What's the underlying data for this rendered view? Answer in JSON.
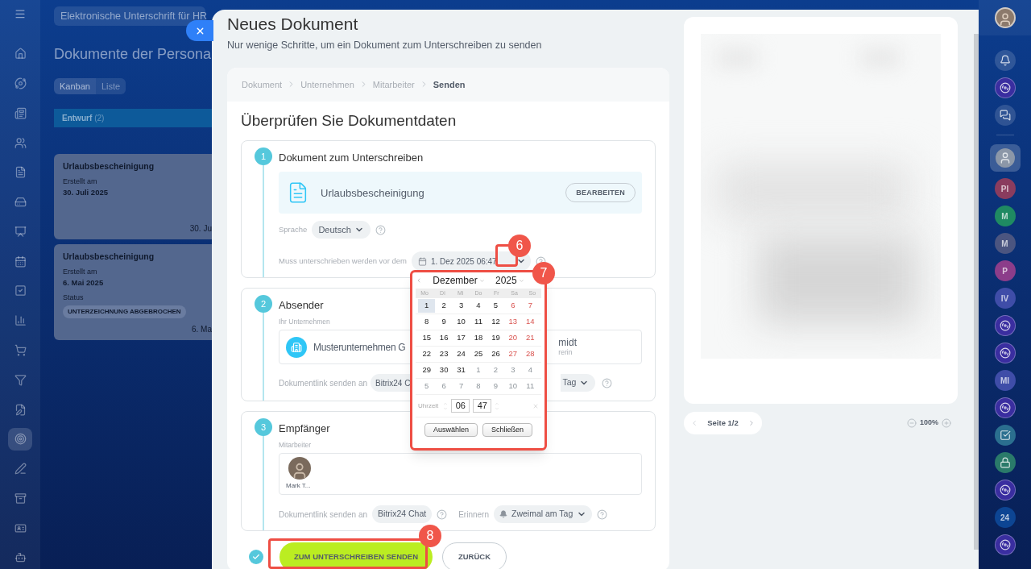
{
  "left_nav": [
    {
      "selected": false
    },
    {
      "selected": false
    },
    {
      "selected": false
    },
    {
      "selected": false
    },
    {
      "selected": false
    },
    {
      "selected": false
    },
    {
      "selected": false
    },
    {
      "selected": false
    },
    {
      "selected": false
    },
    {
      "selected": false
    },
    {
      "selected": false
    },
    {
      "selected": false
    },
    {
      "selected": false
    },
    {
      "selected": true
    },
    {
      "selected": false
    },
    {
      "selected": false
    },
    {
      "selected": false
    },
    {
      "selected": false
    }
  ],
  "background_page": {
    "search": "Elektronische Unterschrift für HR",
    "title": "Dokumente der Persona",
    "tabs": [
      {
        "label": "Kanban",
        "selected": true
      },
      {
        "label": "Liste",
        "selected": false
      }
    ],
    "column": {
      "title": "Entwurf",
      "count": "(2)"
    },
    "cards": [
      {
        "title": "Urlaubsbescheinigung",
        "created_label": "Erstellt am",
        "created_date": "30. Juli 2025",
        "footer": "30. Ju"
      },
      {
        "title": "Urlaubsbescheinigung",
        "created_label": "Erstellt am",
        "created_date": "6. Mai 2025",
        "status_label": "Status",
        "status": "UNTERZEICHNUNG ABGEBROCHEN",
        "footer": "6. Ma"
      }
    ]
  },
  "panel": {
    "title": "Neues Dokument",
    "subtitle": "Nur wenige Schritte, um ein Dokument zum Unterschreiben zu senden",
    "breadcrumb": [
      {
        "label": "Dokument",
        "selected": false
      },
      {
        "label": "Unternehmen",
        "selected": false
      },
      {
        "label": "Mitarbeiter",
        "selected": false
      },
      {
        "label": "Senden",
        "selected": true
      }
    ],
    "heading": "Überprüfen Sie Dokumentdaten",
    "step1": {
      "number": "1",
      "title": "Dokument zum Unterschreiben",
      "document": "Urlaubsbescheinigung",
      "edit_button": "BEARBEITEN",
      "language_label": "Sprache",
      "language": "Deutsch",
      "deadline_label": "Muss unterschrieben werden vor dem",
      "deadline": "1. Dez 2025 06:47"
    },
    "step2": {
      "number": "2",
      "title": "Absender",
      "company_label": "Ihr Unternehmen",
      "company": "Musterunternehmen G",
      "person_name": "midt",
      "person_role": "rerin",
      "link_label": "Dokumentlink senden an",
      "link_channel": "Bitrix24 C",
      "reminder": "Tag"
    },
    "step3": {
      "number": "3",
      "title": "Empfänger",
      "employee_label": "Mitarbeiter",
      "employee": "Mark T...",
      "link_label": "Dokumentlink senden an",
      "link_channel": "Bitrix24 Chat",
      "reminder_label": "Erinnern",
      "reminder": "Zweimal am Tag"
    },
    "send_button": "ZUM UNTERSCHREIBEN SENDEN",
    "back_button": "ZURÜCK"
  },
  "preview": {
    "page": "Seite 1/2",
    "zoom": "100%"
  },
  "calendar": {
    "month": "Dezember",
    "year": "2025",
    "weekdays": [
      "Mo",
      "Di",
      "Mi",
      "Do",
      "Fr",
      "Sa",
      "So"
    ],
    "weeks": [
      [
        {
          "day": "1",
          "kind": "weekday",
          "selected": true
        },
        {
          "day": "2",
          "kind": "weekday",
          "selected": false
        },
        {
          "day": "3",
          "kind": "weekday",
          "selected": false
        },
        {
          "day": "4",
          "kind": "weekday",
          "selected": false
        },
        {
          "day": "5",
          "kind": "weekday",
          "selected": false
        },
        {
          "day": "6",
          "kind": "weekend",
          "selected": false
        },
        {
          "day": "7",
          "kind": "weekend",
          "selected": false
        }
      ],
      [
        {
          "day": "8",
          "kind": "weekday",
          "selected": false
        },
        {
          "day": "9",
          "kind": "weekday",
          "selected": false
        },
        {
          "day": "10",
          "kind": "weekday",
          "selected": false
        },
        {
          "day": "11",
          "kind": "weekday",
          "selected": false
        },
        {
          "day": "12",
          "kind": "weekday",
          "selected": false
        },
        {
          "day": "13",
          "kind": "weekend",
          "selected": false
        },
        {
          "day": "14",
          "kind": "weekend",
          "selected": false
        }
      ],
      [
        {
          "day": "15",
          "kind": "weekday",
          "selected": false
        },
        {
          "day": "16",
          "kind": "weekday",
          "selected": false
        },
        {
          "day": "17",
          "kind": "weekday",
          "selected": false
        },
        {
          "day": "18",
          "kind": "weekday",
          "selected": false
        },
        {
          "day": "19",
          "kind": "weekday",
          "selected": false
        },
        {
          "day": "20",
          "kind": "weekend",
          "selected": false
        },
        {
          "day": "21",
          "kind": "weekend",
          "selected": false
        }
      ],
      [
        {
          "day": "22",
          "kind": "weekday",
          "selected": false
        },
        {
          "day": "23",
          "kind": "weekday",
          "selected": false
        },
        {
          "day": "24",
          "kind": "weekday",
          "selected": false
        },
        {
          "day": "25",
          "kind": "weekday",
          "selected": false
        },
        {
          "day": "26",
          "kind": "weekday",
          "selected": false
        },
        {
          "day": "27",
          "kind": "weekend",
          "selected": false
        },
        {
          "day": "28",
          "kind": "weekend",
          "selected": false
        }
      ],
      [
        {
          "day": "29",
          "kind": "weekday",
          "selected": false
        },
        {
          "day": "30",
          "kind": "weekday",
          "selected": false
        },
        {
          "day": "31",
          "kind": "weekday",
          "selected": false
        },
        {
          "day": "1",
          "kind": "other",
          "selected": false
        },
        {
          "day": "2",
          "kind": "other",
          "selected": false
        },
        {
          "day": "3",
          "kind": "other",
          "selected": false
        },
        {
          "day": "4",
          "kind": "other",
          "selected": false
        }
      ],
      [
        {
          "day": "5",
          "kind": "other",
          "selected": false
        },
        {
          "day": "6",
          "kind": "other",
          "selected": false
        },
        {
          "day": "7",
          "kind": "other",
          "selected": false
        },
        {
          "day": "8",
          "kind": "other",
          "selected": false
        },
        {
          "day": "9",
          "kind": "other",
          "selected": false
        },
        {
          "day": "10",
          "kind": "other",
          "selected": false
        },
        {
          "day": "11",
          "kind": "other",
          "selected": false
        }
      ]
    ],
    "time_label": "Uhrzeit",
    "hour": "06",
    "minute": "47",
    "select_button": "Auswählen",
    "close_button": "Schließen"
  },
  "annotations": [
    {
      "label": "6"
    },
    {
      "label": "7"
    },
    {
      "label": "8"
    }
  ],
  "right_rail": [
    {
      "kind": "bell"
    },
    {
      "kind": "swirl"
    },
    {
      "kind": "chat"
    },
    {
      "kind": "divider"
    },
    {
      "kind": "avatar",
      "selected": true
    },
    {
      "kind": "initials",
      "text": "PI",
      "color": "#8a3c5e"
    },
    {
      "kind": "initials",
      "text": "M",
      "color": "#1f8a62"
    },
    {
      "kind": "initials",
      "text": "M",
      "color": "#4b5580"
    },
    {
      "kind": "initials",
      "text": "P",
      "color": "#8c3d8a"
    },
    {
      "kind": "initials",
      "text": "IV",
      "color": "#3f4da8"
    },
    {
      "kind": "swirl"
    },
    {
      "kind": "swirl"
    },
    {
      "kind": "initials",
      "text": "MI",
      "color": "#3f4da8"
    },
    {
      "kind": "swirl"
    },
    {
      "kind": "tasks"
    },
    {
      "kind": "lock"
    },
    {
      "kind": "swirl"
    },
    {
      "kind": "initials",
      "text": "24",
      "color": "#0d4593"
    },
    {
      "kind": "swirl"
    }
  ]
}
